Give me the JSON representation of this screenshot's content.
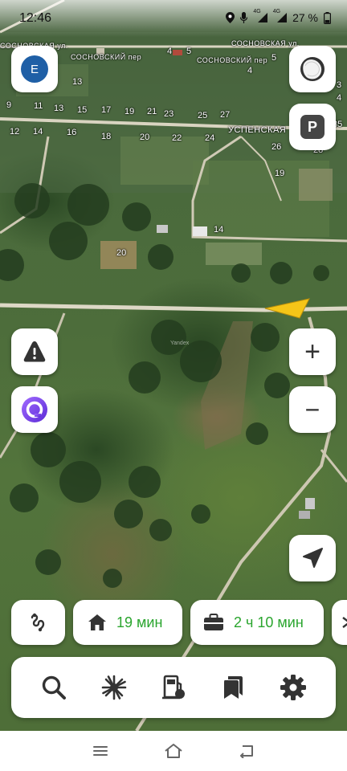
{
  "status_bar": {
    "time": "12:46",
    "network_badge_1": "4G",
    "network_badge_2": "4G",
    "battery": "27 %"
  },
  "map": {
    "street_labels": [
      "СОСНОВСКАЯ ул.",
      "СОСНОВСКАЯ ул.",
      "СОСНОВСКИЙ пер",
      "СОСНОВСКИЙ пер",
      "УСПЕНСКАЯ"
    ],
    "house_numbers": [
      "5",
      "4",
      "5",
      "4",
      "13",
      "9",
      "11",
      "13",
      "15",
      "17",
      "19",
      "21",
      "23",
      "25",
      "27",
      "12",
      "14",
      "16",
      "18",
      "20",
      "22",
      "24",
      "26",
      "28",
      "35",
      "19",
      "14",
      "20",
      "3",
      "4"
    ],
    "watermark": "Yandex",
    "colors": {
      "road": "#dcd8c8",
      "user_arrow": "#f5c518"
    }
  },
  "controls": {
    "profile_initial": "E",
    "parking_label": "P",
    "zoom_in_label": "+",
    "zoom_out_label": "−"
  },
  "route_bar": {
    "home_time": "19 мин",
    "work_time": "2 ч 10 мин",
    "accent_color": "#2aa52e"
  },
  "toolbar": {
    "icons": [
      "search-icon",
      "sun-burst-icon",
      "fuel-station-icon",
      "bookmarks-icon",
      "settings-gear-icon"
    ]
  },
  "navbar": {
    "icons": [
      "menu-icon",
      "home-icon",
      "back-icon"
    ]
  }
}
